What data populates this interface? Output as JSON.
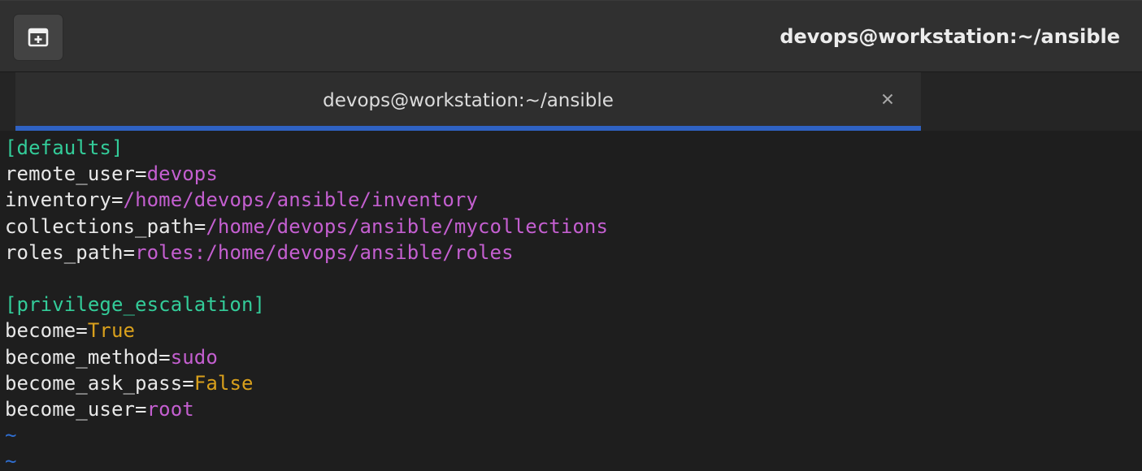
{
  "window": {
    "title": "devops@workstation:~/ansible"
  },
  "headerbar": {
    "new_tab_icon": "new-tab-icon"
  },
  "tab": {
    "label": "devops@workstation:~/ansible",
    "close_glyph": "×",
    "close_icon": "close-icon"
  },
  "colors": {
    "section": "#33cc99",
    "string_value": "#c45fd0",
    "boolean_value": "#d9a01c",
    "tilde": "#2f6ed0",
    "tab_indicator": "#2f62c3"
  },
  "file": {
    "lines": [
      {
        "section": "[defaults]"
      },
      {
        "key": "remote_user",
        "eq": "=",
        "value": "devops",
        "kind": "str"
      },
      {
        "key": "inventory",
        "eq": "=",
        "value": "/home/devops/ansible/inventory",
        "kind": "str"
      },
      {
        "key": "collections_path",
        "eq": "=",
        "value": "/home/devops/ansible/mycollections",
        "kind": "str"
      },
      {
        "key": "roles_path",
        "eq": "=",
        "value": "roles:/home/devops/ansible/roles",
        "kind": "str"
      },
      {
        "blank": ""
      },
      {
        "section": "[privilege_escalation]"
      },
      {
        "key": "become",
        "eq": "=",
        "value": "True",
        "kind": "bool"
      },
      {
        "key": "become_method",
        "eq": "=",
        "value": "sudo",
        "kind": "str"
      },
      {
        "key": "become_ask_pass",
        "eq": "=",
        "value": "False",
        "kind": "bool"
      },
      {
        "key": "become_user",
        "eq": "=",
        "value": "root",
        "kind": "str"
      },
      {
        "tilde": "~"
      },
      {
        "tilde": "~"
      }
    ]
  }
}
